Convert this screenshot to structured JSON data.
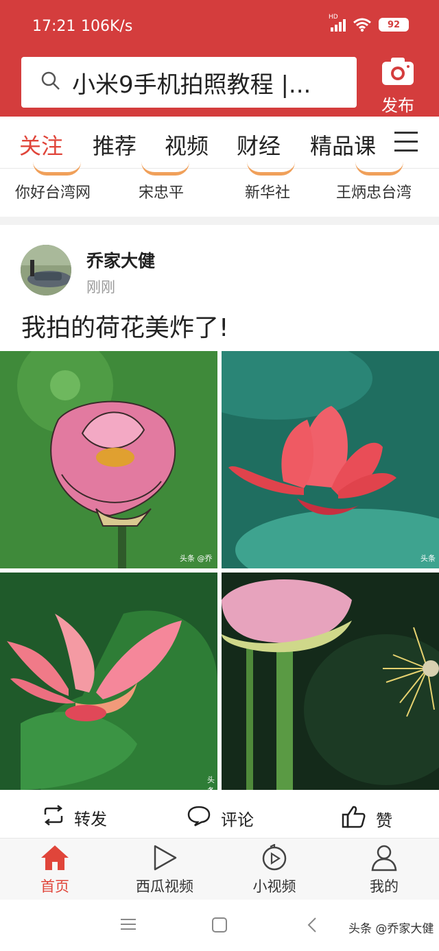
{
  "status": {
    "time": "17:21",
    "speed": "106K/s",
    "network": "HD",
    "battery": "92"
  },
  "search": {
    "text": "小米9手机拍照教程 |..."
  },
  "header": {
    "publish_label": "发布"
  },
  "tabs": [
    {
      "label": "关注",
      "active": true
    },
    {
      "label": "推荐",
      "active": false
    },
    {
      "label": "视频",
      "active": false
    },
    {
      "label": "财经",
      "active": false
    },
    {
      "label": "精品课",
      "active": false
    }
  ],
  "follow": [
    "你好台湾网",
    "宋忠平",
    "新华社",
    "王炳忠台湾"
  ],
  "post": {
    "author": "乔家大健",
    "time": "刚刚",
    "title": "我拍的荷花美炸了!",
    "watermarks": [
      "头条 @乔",
      "头条",
      "头条"
    ]
  },
  "actions": {
    "repost": "转发",
    "comment": "评论",
    "like": "赞"
  },
  "bottom_nav": [
    {
      "label": "首页",
      "icon": "home-icon",
      "active": true
    },
    {
      "label": "西瓜视频",
      "icon": "play-icon",
      "active": false
    },
    {
      "label": "小视频",
      "icon": "short-video-icon",
      "active": false
    },
    {
      "label": "我的",
      "icon": "user-icon",
      "active": false
    }
  ],
  "system": {
    "watermark": "头条 @乔家大健"
  },
  "colors": {
    "brand": "#d43d3d",
    "accent": "#e0453a"
  }
}
